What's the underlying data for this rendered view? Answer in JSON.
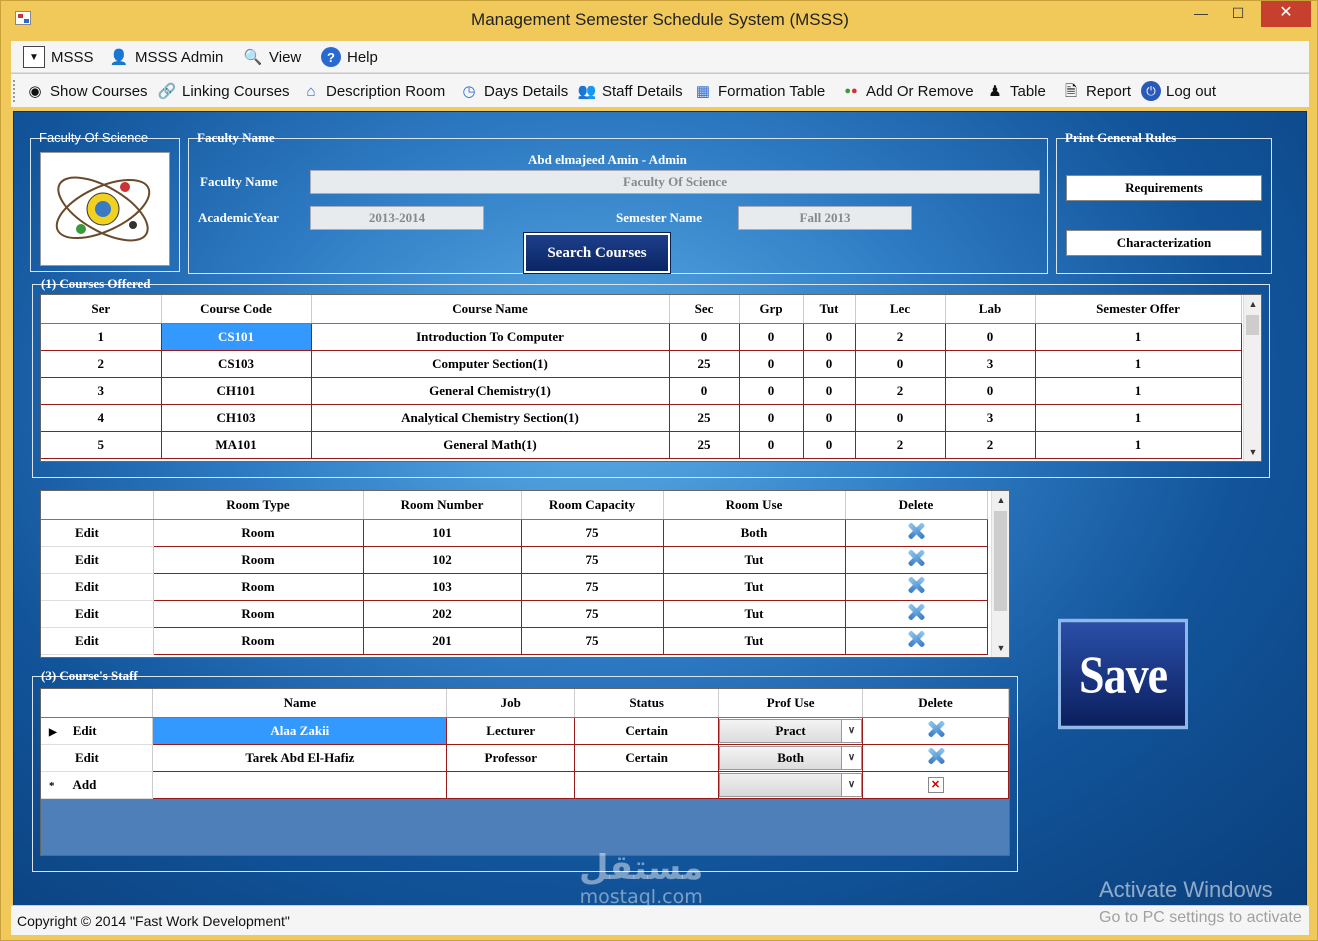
{
  "window": {
    "title": "Management Semester Schedule System (MSSS)"
  },
  "menu": {
    "items": [
      {
        "label": "MSSS",
        "icon": "dropdown-icon"
      },
      {
        "label": "MSSS Admin",
        "icon": "admin-user-icon"
      },
      {
        "label": "View",
        "icon": "view-icon"
      },
      {
        "label": "Help",
        "icon": "help-icon"
      }
    ]
  },
  "toolbar": {
    "items": [
      {
        "label": "Show Courses",
        "icon": "eye-icon"
      },
      {
        "label": "Linking Courses",
        "icon": "link-icon"
      },
      {
        "label": "Description Room",
        "icon": "home-icon"
      },
      {
        "label": "Days Details",
        "icon": "clock-icon"
      },
      {
        "label": "Staff Details",
        "icon": "staff-icon"
      },
      {
        "label": "Formation Table",
        "icon": "table-icon"
      },
      {
        "label": "Add Or Remove",
        "icon": "add-remove-icon"
      },
      {
        "label": "Table",
        "icon": "table-person-icon"
      },
      {
        "label": "Report",
        "icon": "report-icon"
      },
      {
        "label": "Log out",
        "icon": "logout-icon"
      }
    ]
  },
  "faculty_group": {
    "label": "Faculty Of Science"
  },
  "faculty_name_group": {
    "label": "Faculty Name",
    "user": "Abd elmajeed Amin - Admin",
    "faculty_label": "Faculty Name",
    "faculty_value": "Faculty Of Science",
    "year_label": "AcademicYear",
    "year_value": "2013-2014",
    "semester_label": "Semester Name",
    "semester_value": "Fall 2013",
    "search_button": "Search Courses"
  },
  "print_rules": {
    "label": "Print General Rules",
    "requirements": "Requirements",
    "characterization": "Characterization"
  },
  "courses": {
    "label": "(1) Courses Offered",
    "columns": [
      "Ser",
      "Course Code",
      "Course Name",
      "Sec",
      "Grp",
      "Tut",
      "Lec",
      "Lab",
      "Semester Offer"
    ],
    "rows": [
      [
        "1",
        "CS101",
        "Introduction To Computer",
        "0",
        "0",
        "0",
        "2",
        "0",
        "1"
      ],
      [
        "2",
        "CS103",
        "Computer Section(1)",
        "25",
        "0",
        "0",
        "0",
        "3",
        "1"
      ],
      [
        "3",
        "CH101",
        "General Chemistry(1)",
        "0",
        "0",
        "0",
        "2",
        "0",
        "1"
      ],
      [
        "4",
        "CH103",
        "Analytical Chemistry Section(1)",
        "25",
        "0",
        "0",
        "0",
        "3",
        "1"
      ],
      [
        "5",
        "MA101",
        "General Math(1)",
        "25",
        "0",
        "0",
        "2",
        "2",
        "1"
      ]
    ]
  },
  "rooms": {
    "columns": [
      "",
      "Room Type",
      "Room Number",
      "Room Capacity",
      "Room Use",
      "Delete"
    ],
    "rows": [
      [
        "Edit",
        "Room",
        "101",
        "75",
        "Both"
      ],
      [
        "Edit",
        "Room",
        "102",
        "75",
        "Tut"
      ],
      [
        "Edit",
        "Room",
        "103",
        "75",
        "Tut"
      ],
      [
        "Edit",
        "Room",
        "202",
        "75",
        "Tut"
      ],
      [
        "Edit",
        "Room",
        "201",
        "75",
        "Tut"
      ]
    ]
  },
  "staff": {
    "label": "(3) Course's Staff",
    "columns": [
      "",
      "Name",
      "Job",
      "Status",
      "Prof Use",
      "Delete"
    ],
    "rows": [
      [
        "Edit",
        "Alaa Zakii",
        "Lecturer",
        "Certain",
        "Pract"
      ],
      [
        "Edit",
        "Tarek Abd El-Hafiz",
        "Professor",
        "Certain",
        "Both"
      ],
      [
        "Add",
        "",
        "",
        "",
        ""
      ]
    ]
  },
  "save_button": "Save",
  "status": {
    "copyright": "Copyright © 2014 \"Fast Work Development\""
  },
  "watermark": {
    "arabic": "مستقل",
    "latin": "mostaql.com"
  },
  "activation": {
    "title": "Activate Windows",
    "subtitle": "Go to PC settings to activate"
  },
  "colors": {
    "accent": "#3399ff",
    "grid_line": "#9a1a1a",
    "background": "#12549a",
    "frame": "#f0c95a"
  }
}
